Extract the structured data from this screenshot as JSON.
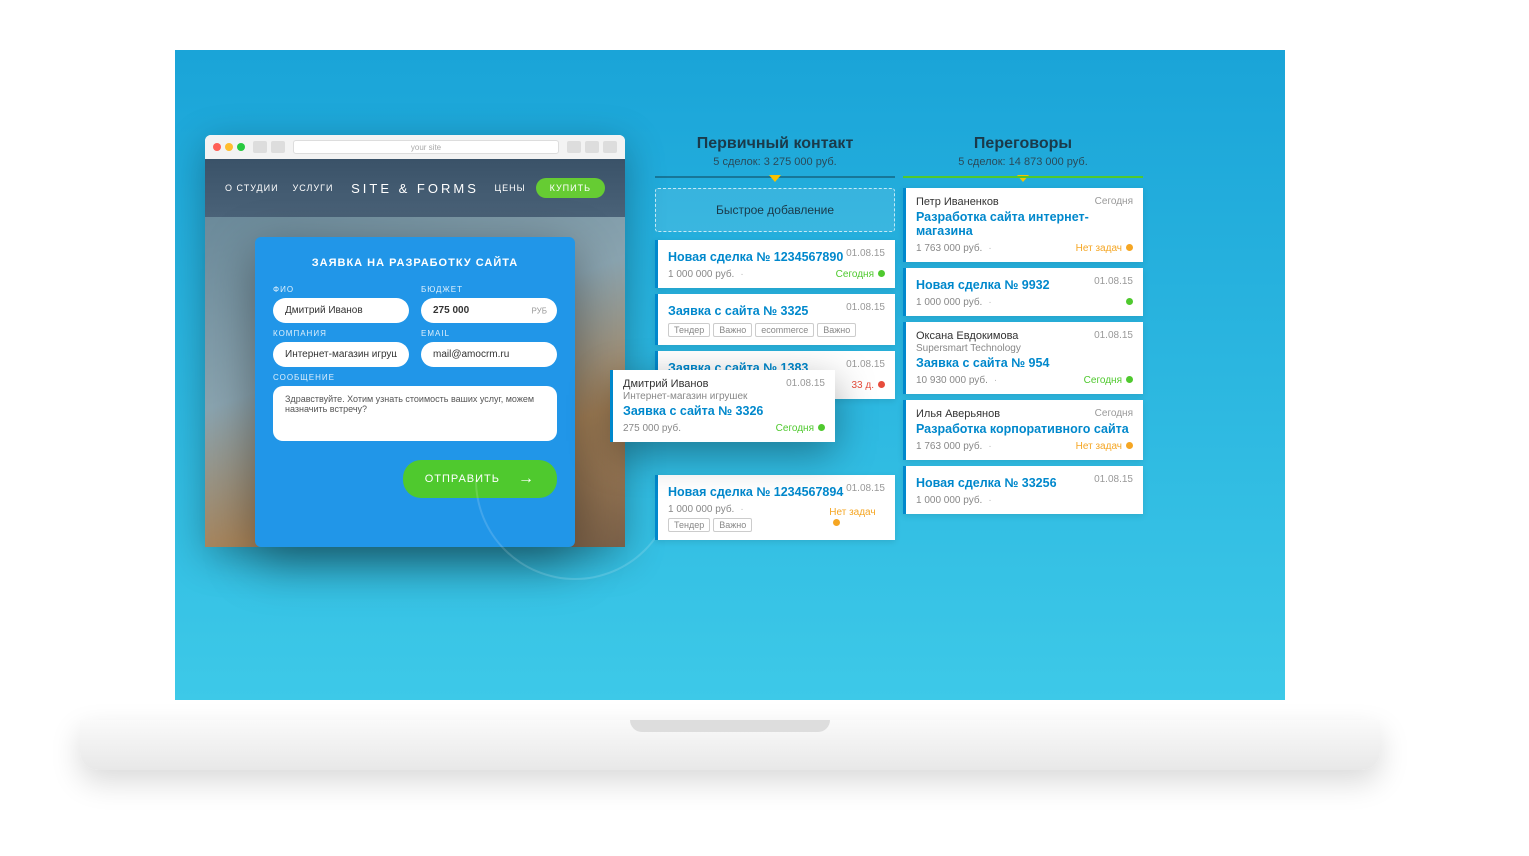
{
  "browser": {
    "url": "your site"
  },
  "site": {
    "nav_left": [
      "О СТУДИИ",
      "УСЛУГИ"
    ],
    "logo": "SITE & FORMS",
    "nav_price": "ЦЕНЫ",
    "buy": "КУПИТЬ"
  },
  "form": {
    "title": "ЗАЯВКА НА РАЗРАБОТКУ САЙТА",
    "fio_label": "ФИО",
    "fio_value": "Дмитрий Иванов",
    "budget_label": "БЮДЖЕТ",
    "budget_value": "275 000",
    "budget_suffix": "РУБ",
    "company_label": "КОМПАНИЯ",
    "company_value": "Интернет-магазин игрушек",
    "email_label": "EMAIL",
    "email_value": "mail@amocrm.ru",
    "message_label": "СООБЩЕНИЕ",
    "message_value": "Здравствуйте. Хотим узнать стоимость ваших услуг, можем назначить встречу?",
    "submit": "ОТПРАВИТЬ"
  },
  "pipeline": {
    "col1": {
      "title": "Первичный контакт",
      "sub": "5 сделок: 3 275 000 руб.",
      "quick_add": "Быстрое добавление",
      "deals": [
        {
          "link": "Новая сделка № 1234567890",
          "date": "01.08.15",
          "amount": "1 000 000 руб.",
          "status": "Сегодня",
          "status_cls": "stat-today",
          "ind": "ind-green"
        },
        {
          "link": "Заявка с сайта № 3325",
          "date": "01.08.15",
          "tags": [
            "Тендер",
            "Важно",
            "ecommerce",
            "Важно"
          ]
        },
        {
          "link": "Заявка с сайта № 1383",
          "date": "01.08.15",
          "status": "33 д.",
          "status_cls": "stat-days",
          "ind": "ind-red"
        },
        {
          "link": "Новая сделка № 1234567894",
          "date": "01.08.15",
          "amount": "1 000 000 руб.",
          "tags": [
            "Тендер",
            "Важно"
          ],
          "status": "Нет задач",
          "status_cls": "stat-no",
          "ind": "ind-orange"
        }
      ]
    },
    "col2": {
      "title": "Переговоры",
      "sub": "5 сделок: 14 873 000 руб.",
      "deals": [
        {
          "person": "Петр Иваненков",
          "date2": "Сегодня",
          "link": "Разработка сайта интернет-магазина",
          "amount": "1 763 000 руб.",
          "status": "Нет задач",
          "status_cls": "stat-no",
          "ind": "ind-orange"
        },
        {
          "link": "Новая сделка № 9932",
          "date": "01.08.15",
          "amount": "1 000 000 руб.",
          "ind": "ind-green"
        },
        {
          "person": "Оксана Евдокимова",
          "company": "Supersmart Technology",
          "date": "01.08.15",
          "link": "Заявка с сайта № 954",
          "amount": "10 930 000 руб.",
          "status": "Сегодня",
          "status_cls": "stat-today",
          "ind": "ind-green"
        },
        {
          "person": "Илья Аверьянов",
          "date2": "Сегодня",
          "link": "Разработка корпоративного сайта",
          "amount": "1 763 000 руб.",
          "status": "Нет задач",
          "status_cls": "stat-no",
          "ind": "ind-orange"
        },
        {
          "link": "Новая сделка № 33256",
          "date": "01.08.15",
          "amount": "1 000 000 руб."
        }
      ]
    }
  },
  "floating": {
    "person": "Дмитрий Иванов",
    "company": "Интернет-магазин игрушек",
    "date": "01.08.15",
    "link": "Заявка с сайта № 3326",
    "amount": "275 000 руб.",
    "status": "Сегодня",
    "status_cls": "stat-today",
    "ind": "ind-green"
  }
}
